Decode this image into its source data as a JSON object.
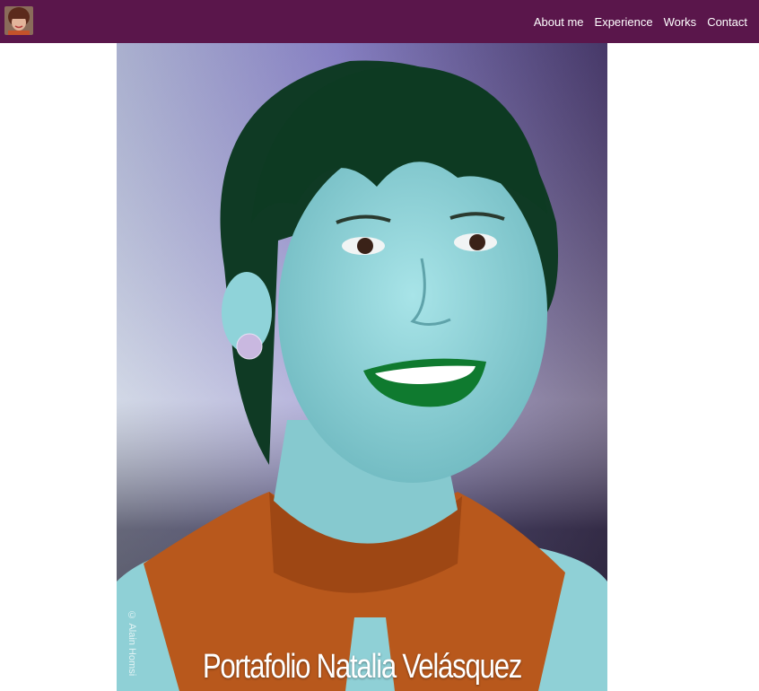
{
  "navbar": {
    "logo_alt": "Natalia Velásquez",
    "links": [
      {
        "label": "About me"
      },
      {
        "label": "Experience"
      },
      {
        "label": "Works"
      },
      {
        "label": "Contact"
      }
    ]
  },
  "hero": {
    "title": "Portafolio Natalia Velásquez",
    "photo_credit": "© Alain Homsi",
    "image_alt": "Portrait of Natalia Velásquez"
  },
  "colors": {
    "navbar": "#5a164b",
    "nav_text": "#ffffff",
    "background": "#ffffff"
  }
}
